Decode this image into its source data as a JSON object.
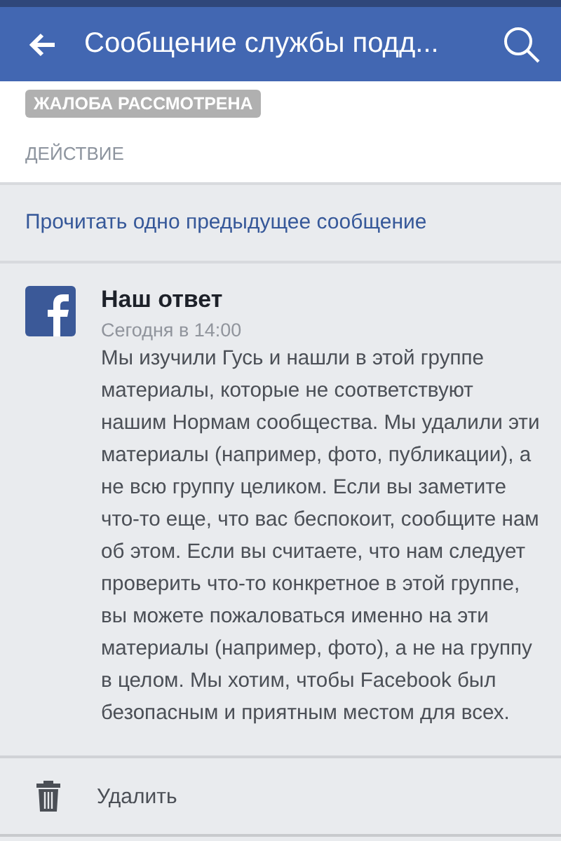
{
  "header": {
    "title": "Сообщение службы подд..."
  },
  "status_badge": "ЖАЛОБА РАССМОТРЕНА",
  "section_label": "ДЕЙСТВИЕ",
  "link": "Прочитать одно предыдущее сообщение",
  "message": {
    "author": "Наш ответ",
    "time": "Сегодня в 14:00",
    "body": "Мы изучили Гусь и нашли в этой группе материалы, которые не соответствуют нашим Нормам сообщества. Мы удалили эти материалы (например, фото, публикации), а не всю группу целиком. Если вы заметите что-то еще, что вас беспокоит, сообщите нам об этом. Если вы считаете, что нам следует проверить что-то конкретное в этой группе, вы можете пожаловаться именно на эти материалы (например, фото), а не на группу в целом. Мы хотим, чтобы Facebook был безопасным и приятным местом для всех."
  },
  "actions": [
    {
      "label": "Удалить"
    }
  ]
}
